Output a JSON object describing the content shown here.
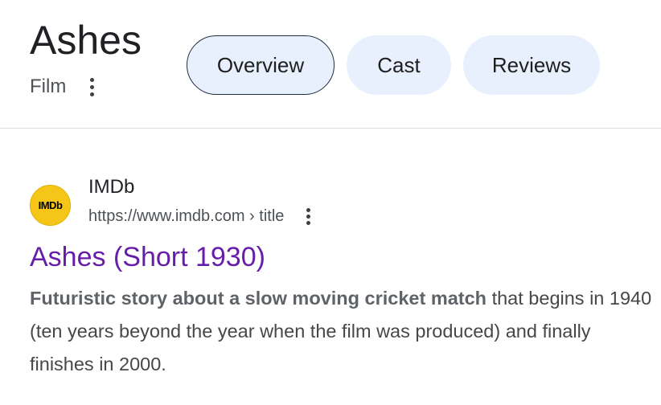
{
  "entity": {
    "title": "Ashes",
    "type": "Film"
  },
  "tabs": [
    {
      "label": "Overview",
      "selected": true
    },
    {
      "label": "Cast",
      "selected": false
    },
    {
      "label": "Reviews",
      "selected": false
    }
  ],
  "result": {
    "favicon_text": "IMDb",
    "site_name": "IMDb",
    "url": "https://www.imdb.com › title",
    "title": "Ashes (Short 1930)",
    "snippet_bold": "Futuristic story about a slow moving cricket match",
    "snippet_rest": " that begins in 1940 (ten years beyond the year when the film was produced) and finally finishes in 2000."
  },
  "colors": {
    "chip_bg": "#e8f0fe",
    "visited_link": "#681da8",
    "imdb_yellow": "#f5c518",
    "divider": "#dadce0"
  },
  "icons": {
    "entity_menu": "more-vert-icon",
    "result_menu": "more-vert-icon"
  }
}
